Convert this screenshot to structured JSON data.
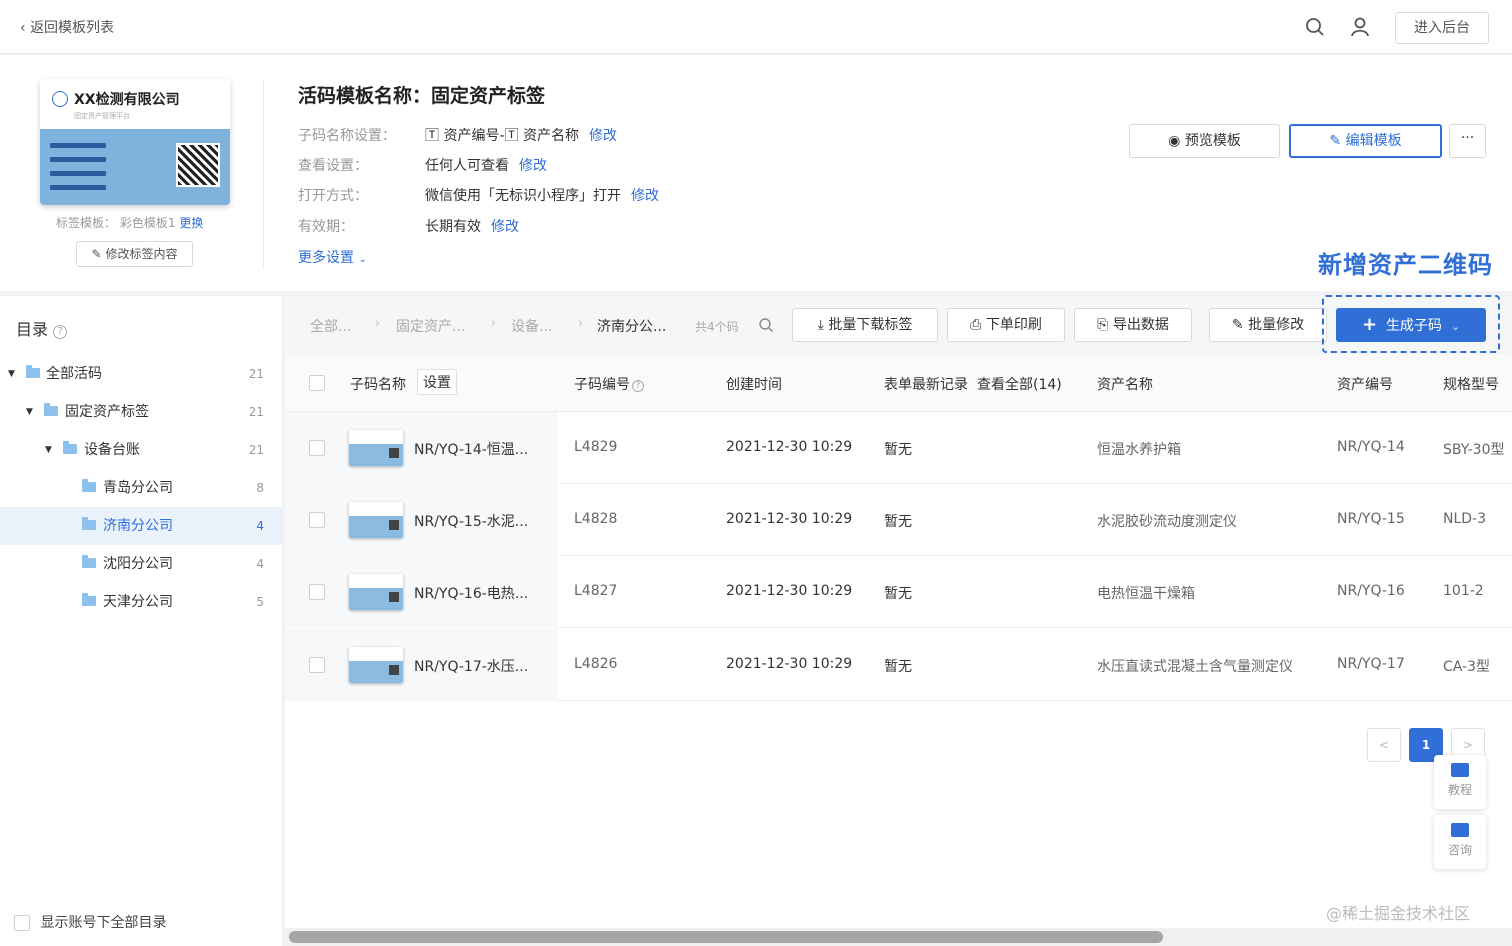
{
  "topbar": {
    "back_label": "返回模板列表",
    "admin_label": "进入后台"
  },
  "label_preview": {
    "company": "XX检测有限公司",
    "subtitle": "固定资产管理平台",
    "template_prefix": "标签模板：",
    "template_name": "彩色模板1",
    "change_label": "更换",
    "edit_content_label": "修改标签内容"
  },
  "template": {
    "title": "活码模板名称：固定资产标签",
    "settings": [
      {
        "key": "子码名称设置：",
        "value": "🅃 资产编号-🅃 资产名称",
        "action": "修改"
      },
      {
        "key": "查看设置：",
        "value": "任何人可查看",
        "action": "修改"
      },
      {
        "key": "打开方式：",
        "value": "微信使用「无标识小程序」打开",
        "action": "修改"
      },
      {
        "key": "有效期：",
        "value": "长期有效",
        "action": "修改"
      }
    ],
    "more_settings": "更多设置",
    "preview_label": "预览模板",
    "edit_label": "编辑模板",
    "more_label": "···"
  },
  "annotation": "新增资产二维码",
  "sidebar": {
    "title": "目录",
    "items": [
      {
        "name": "全部活码",
        "count": "21"
      },
      {
        "name": "固定资产标签",
        "count": "21"
      },
      {
        "name": "设备台账",
        "count": "21"
      },
      {
        "name": "青岛分公司",
        "count": "8"
      },
      {
        "name": "济南分公司",
        "count": "4"
      },
      {
        "name": "沈阳分公司",
        "count": "4"
      },
      {
        "name": "天津分公司",
        "count": "5"
      }
    ],
    "show_all_label": "显示账号下全部目录"
  },
  "toolbar": {
    "breadcrumbs": [
      "全部...",
      "固定资产...",
      "设备...",
      "济南分公..."
    ],
    "count_label": "共4个码",
    "batch_download": "批量下载标签",
    "order_print": "下单印刷",
    "export_data": "导出数据",
    "batch_edit": "批量修改",
    "generate": "生成子码"
  },
  "table": {
    "headers": {
      "name": "子码名称",
      "name_setting": "设置",
      "code": "子码编号",
      "created": "创建时间",
      "latest_form": "表单最新记录",
      "view_all": "查看全部(14)",
      "asset_name": "资产名称",
      "asset_no": "资产编号",
      "model": "规格型号"
    },
    "rows": [
      {
        "name": "NR/YQ-14-恒温...",
        "code": "L4829",
        "created": "2021-12-30 10:29",
        "latest": "暂无",
        "asset_name": "恒温水养护箱",
        "asset_no": "NR/YQ-14",
        "model": "SBY-30型"
      },
      {
        "name": "NR/YQ-15-水泥...",
        "code": "L4828",
        "created": "2021-12-30 10:29",
        "latest": "暂无",
        "asset_name": "水泥胶砂流动度测定仪",
        "asset_no": "NR/YQ-15",
        "model": "NLD-3"
      },
      {
        "name": "NR/YQ-16-电热...",
        "code": "L4827",
        "created": "2021-12-30 10:29",
        "latest": "暂无",
        "asset_name": "电热恒温干燥箱",
        "asset_no": "NR/YQ-16",
        "model": "101-2"
      },
      {
        "name": "NR/YQ-17-水压...",
        "code": "L4826",
        "created": "2021-12-30 10:29",
        "latest": "暂无",
        "asset_name": "水压直读式混凝土含气量测定仪",
        "asset_no": "NR/YQ-17",
        "model": "CA-3型"
      }
    ]
  },
  "pagination": {
    "prev": "<",
    "current": "1",
    "next": ">"
  },
  "floating": {
    "tutorial": "教程",
    "consult": "咨询"
  },
  "watermark": "@稀土掘金技术社区"
}
